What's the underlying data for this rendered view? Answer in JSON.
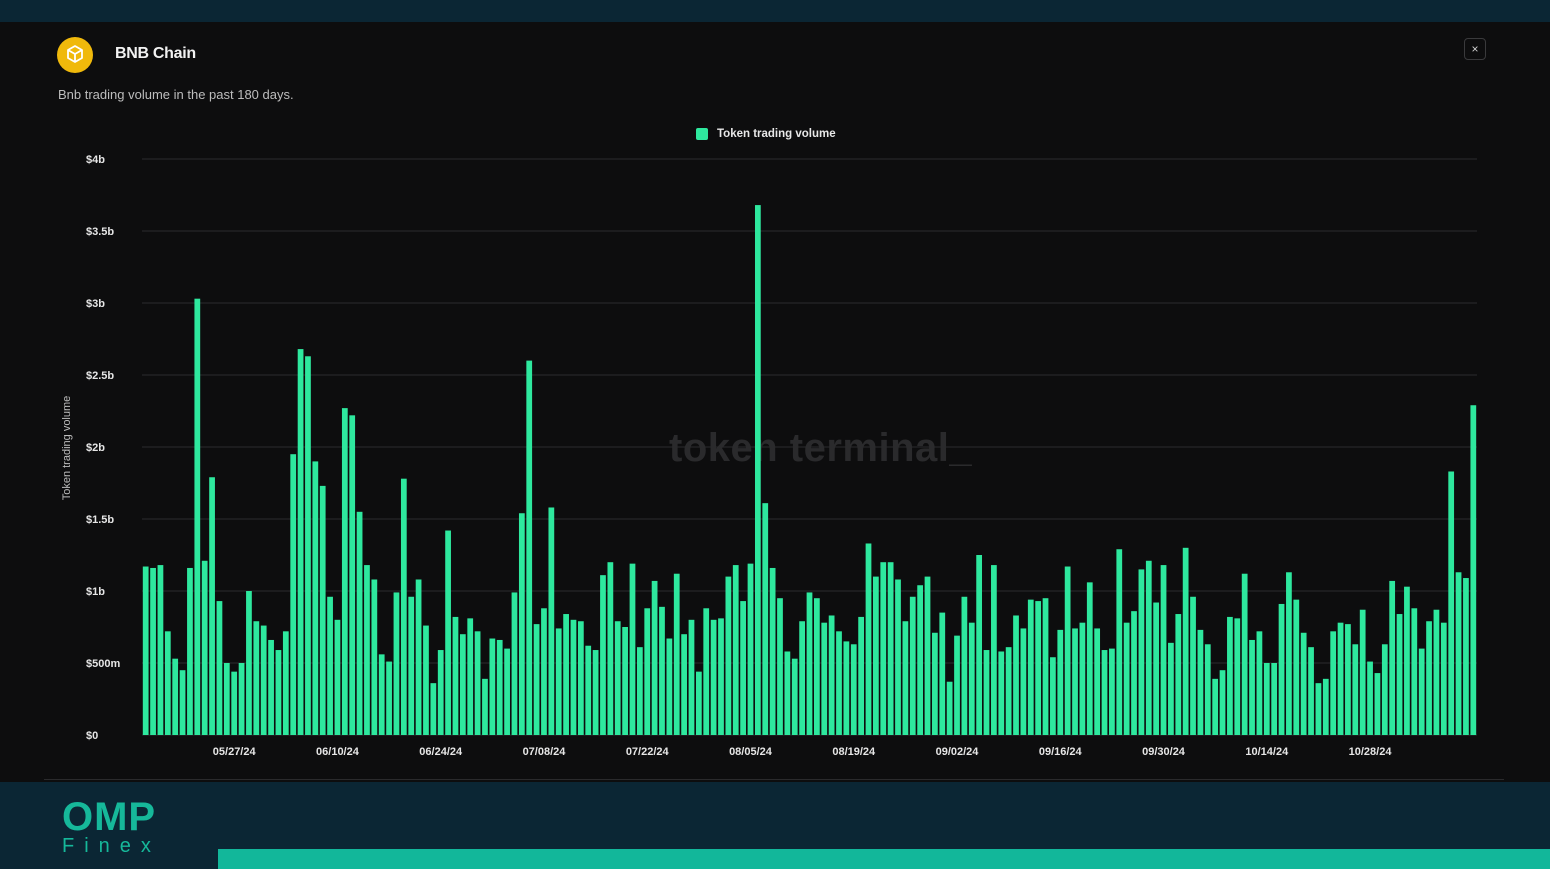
{
  "header": {
    "title": "BNB Chain",
    "subtitle": "Bnb trading volume in the past 180 days.",
    "close_label": "×"
  },
  "watermark": "token terminal_",
  "brand": {
    "name": "OMP",
    "sub": "Finex"
  },
  "colors": {
    "bar": "#2ee89e",
    "panel_bg": "#0d0d0e",
    "page_bg": "#0b2634",
    "brand_accent": "#12b79a",
    "logo_gold": "#f0b90b"
  },
  "chart_data": {
    "type": "bar",
    "title": "",
    "xlabel": "",
    "ylabel": "Token trading volume",
    "legend": {
      "position": "top-center",
      "entries": [
        "Token trading volume"
      ]
    },
    "ylim": [
      0,
      4000000000
    ],
    "y_ticks": [
      {
        "value": 0,
        "label": "$0"
      },
      {
        "value": 500000000,
        "label": "$500m"
      },
      {
        "value": 1000000000,
        "label": "$1b"
      },
      {
        "value": 1500000000,
        "label": "$1.5b"
      },
      {
        "value": 2000000000,
        "label": "$2b"
      },
      {
        "value": 2500000000,
        "label": "$2.5b"
      },
      {
        "value": 3000000000,
        "label": "$3b"
      },
      {
        "value": 3500000000,
        "label": "$3.5b"
      },
      {
        "value": 4000000000,
        "label": "$4b"
      }
    ],
    "x_tick_labels": [
      "05/27/24",
      "06/10/24",
      "06/24/24",
      "07/08/24",
      "07/22/24",
      "08/05/24",
      "08/19/24",
      "09/02/24",
      "09/16/24",
      "09/30/24",
      "10/14/24",
      "10/28/24"
    ],
    "x_tick_bar_index": [
      12,
      26,
      40,
      54,
      68,
      82,
      96,
      110,
      124,
      138,
      152,
      166
    ],
    "grid": true,
    "series": [
      {
        "name": "Token trading volume",
        "values": [
          1170000000,
          1160000000,
          1180000000,
          720000000,
          530000000,
          450000000,
          1160000000,
          3030000000,
          1210000000,
          1790000000,
          930000000,
          500000000,
          440000000,
          500000000,
          1000000000,
          790000000,
          760000000,
          660000000,
          590000000,
          720000000,
          1950000000,
          2680000000,
          2630000000,
          1900000000,
          1730000000,
          960000000,
          800000000,
          2270000000,
          2220000000,
          1550000000,
          1180000000,
          1080000000,
          560000000,
          510000000,
          990000000,
          1780000000,
          960000000,
          1080000000,
          760000000,
          360000000,
          590000000,
          1420000000,
          820000000,
          700000000,
          810000000,
          720000000,
          390000000,
          670000000,
          660000000,
          600000000,
          990000000,
          1540000000,
          2600000000,
          770000000,
          880000000,
          1580000000,
          740000000,
          840000000,
          800000000,
          790000000,
          620000000,
          590000000,
          1110000000,
          1200000000,
          790000000,
          750000000,
          1190000000,
          610000000,
          880000000,
          1070000000,
          890000000,
          670000000,
          1120000000,
          700000000,
          800000000,
          440000000,
          880000000,
          800000000,
          810000000,
          1100000000,
          1180000000,
          930000000,
          1190000000,
          3680000000,
          1610000000,
          1160000000,
          950000000,
          580000000,
          530000000,
          790000000,
          990000000,
          950000000,
          780000000,
          830000000,
          720000000,
          650000000,
          630000000,
          820000000,
          1330000000,
          1100000000,
          1200000000,
          1200000000,
          1080000000,
          790000000,
          960000000,
          1040000000,
          1100000000,
          710000000,
          850000000,
          370000000,
          690000000,
          960000000,
          780000000,
          1250000000,
          590000000,
          1180000000,
          580000000,
          610000000,
          830000000,
          740000000,
          940000000,
          930000000,
          950000000,
          540000000,
          730000000,
          1170000000,
          740000000,
          780000000,
          1060000000,
          740000000,
          590000000,
          600000000,
          1290000000,
          780000000,
          860000000,
          1150000000,
          1210000000,
          920000000,
          1180000000,
          640000000,
          840000000,
          1300000000,
          960000000,
          730000000,
          630000000,
          390000000,
          450000000,
          820000000,
          810000000,
          1120000000,
          660000000,
          720000000,
          500000000,
          500000000,
          910000000,
          1130000000,
          940000000,
          710000000,
          610000000,
          360000000,
          390000000,
          720000000,
          780000000,
          770000000,
          630000000,
          870000000,
          510000000,
          430000000,
          630000000,
          1070000000,
          840000000,
          1030000000,
          880000000,
          600000000,
          790000000,
          870000000,
          780000000,
          1830000000,
          1130000000,
          1090000000,
          2290000000
        ]
      }
    ]
  }
}
